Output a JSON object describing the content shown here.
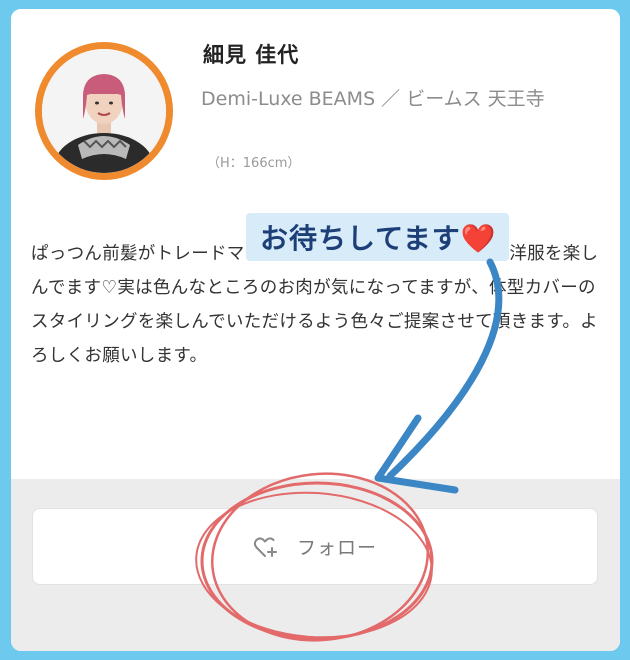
{
  "profile": {
    "name": "細見 佳代",
    "shop": "Demi-Luxe BEAMS ／ ビームス 天王寺",
    "height": "（H：166cm）",
    "bio": "ぱっつん前髪がトレードマーク。年齢や体型にとらわれずお洋服を楽しんでます♡実は色んなところのお肉が気になってますが、体型カバーのスタイリングを楽しんでいただけるよう色々ご提案させて頂きます。よろしくお願いします。"
  },
  "callout": {
    "text": "お待ちしてます",
    "emoji": "❤️"
  },
  "follow": {
    "label": "フォロー",
    "icon": "heart-plus-icon"
  },
  "colors": {
    "border_blue": "#6ec9ef",
    "avatar_ring": "#f08a2e",
    "arrow_blue": "#3b86c4",
    "circle_red": "#e36a6a",
    "callout_bg": "#d7ebf8",
    "callout_text": "#1d3f78"
  }
}
